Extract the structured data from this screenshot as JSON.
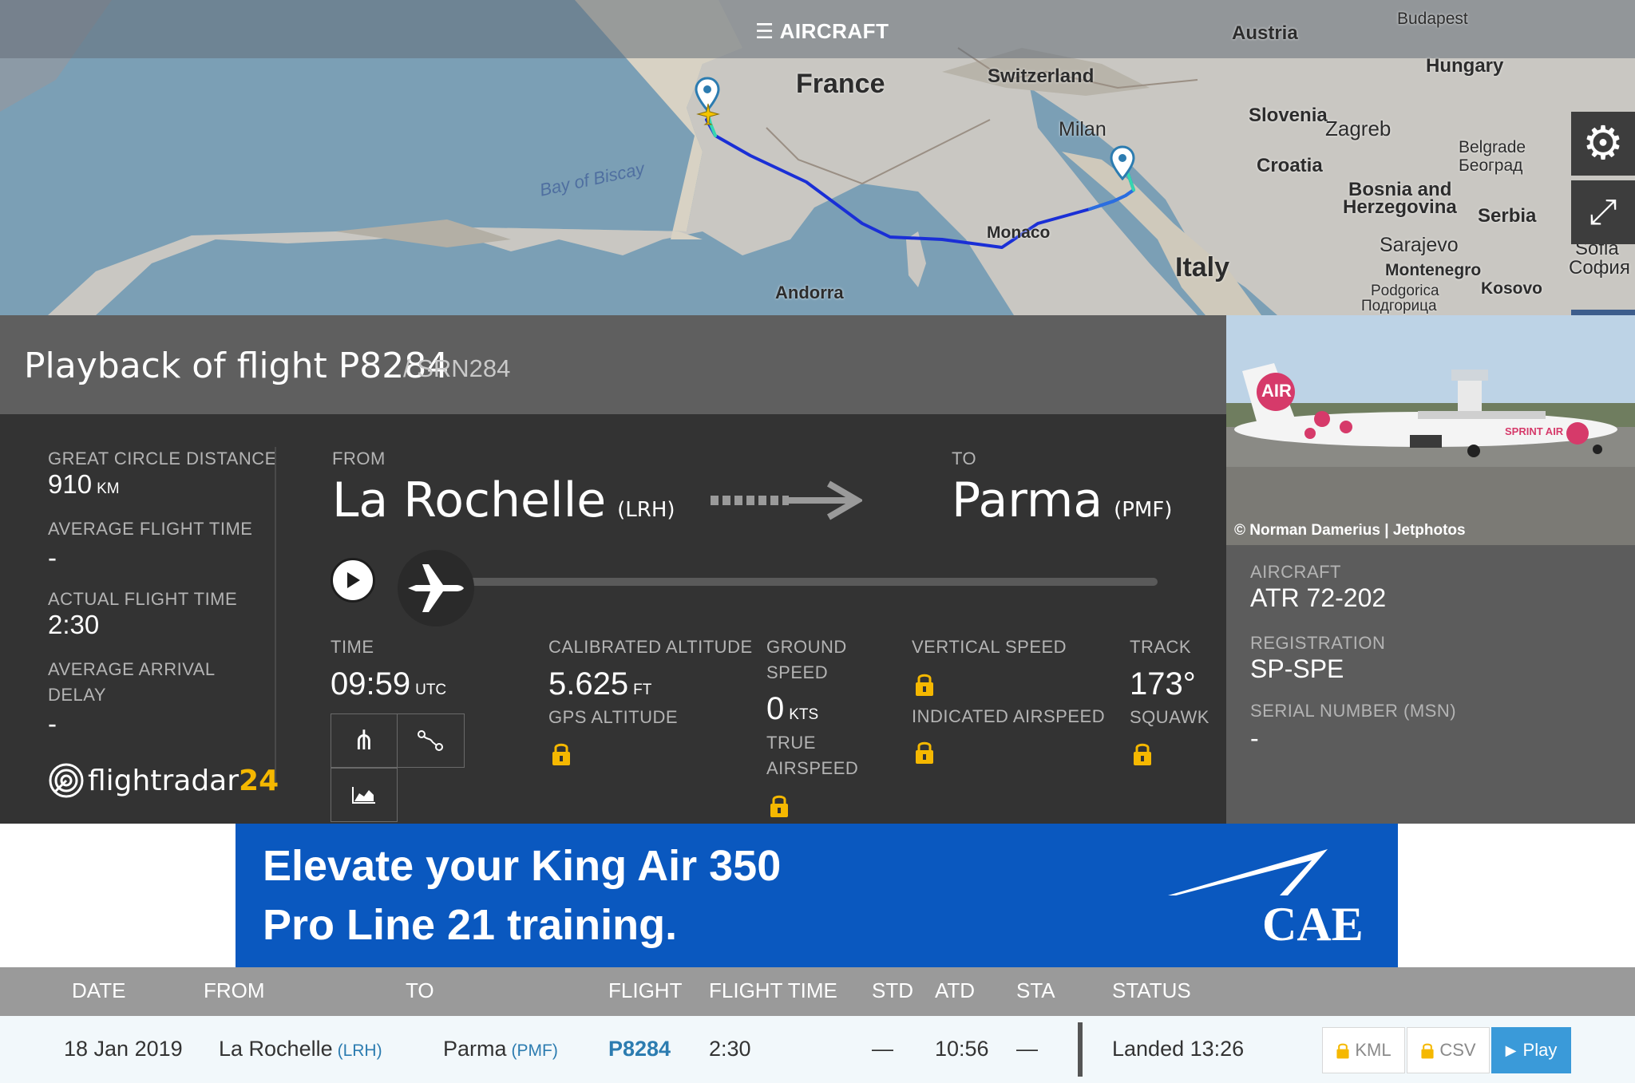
{
  "map": {
    "topbar_label": "AIRCRAFT",
    "labels": {
      "france": "France",
      "switzerland": "Switzerland",
      "austria": "Austria",
      "budapest": "Budapest",
      "hungary": "Hungary",
      "slovenia": "Slovenia",
      "zagreb": "Zagreb",
      "milan": "Milan",
      "croatia": "Croatia",
      "belgrade": "Belgrade",
      "belgrade_cyr": "Београд",
      "bosnia": "Bosnia and",
      "herzegovina": "Herzegovina",
      "serbia": "Serbia",
      "sarajevo": "Sarajevo",
      "montenegro": "Montenegro",
      "podgorica": "Podgorica",
      "podgorica_cyr": "Подгорица",
      "kosovo": "Kosovo",
      "sofia": "Sofia",
      "sofia_cyr": "София",
      "monaco": "Monaco",
      "italy": "Italy",
      "andorra": "Andorra",
      "bay_of_biscay": "Bay of Biscay"
    },
    "track_colors": [
      "#1a2fd6",
      "#2a6ee0",
      "#36d6b0",
      "#a4e05a"
    ]
  },
  "playback": {
    "title": "Playback of flight P8284",
    "callsign": "/ SRN284"
  },
  "stats": {
    "gcd_label": "GREAT CIRCLE DISTANCE",
    "gcd_value": "910",
    "gcd_unit": "KM",
    "aft_label": "AVERAGE FLIGHT TIME",
    "aft_value": "-",
    "actual_label": "ACTUAL FLIGHT TIME",
    "actual_value": "2:30",
    "delay_label_1": "AVERAGE ARRIVAL",
    "delay_label_2": "DELAY",
    "delay_value": "-"
  },
  "route": {
    "from_label": "FROM",
    "from_city": "La Rochelle",
    "from_code": "(LRH)",
    "to_label": "TO",
    "to_city": "Parma",
    "to_code": "(PMF)"
  },
  "playback_progress": 0.0,
  "telemetry": {
    "time_label": "TIME",
    "time_value": "09:59",
    "time_unit": "UTC",
    "cal_alt_label": "CALIBRATED ALTITUDE",
    "cal_alt_value": "5.625",
    "cal_alt_unit": "FT",
    "gps_alt_label": "GPS ALTITUDE",
    "ground_speed_label_1": "GROUND",
    "ground_speed_label_2": "SPEED",
    "ground_speed_value": "0",
    "ground_speed_unit": "KTS",
    "tas_label_1": "TRUE",
    "tas_label_2": "AIRSPEED",
    "vs_label": "VERTICAL SPEED",
    "ias_label": "INDICATED AIRSPEED",
    "track_label": "TRACK",
    "track_value": "173°",
    "squawk_label": "SQUAWK"
  },
  "brand": {
    "name": "flightradar",
    "suffix": "24"
  },
  "aircraft": {
    "photo_credit": "© Norman Damerius | Jetphotos",
    "type_label": "AIRCRAFT",
    "type_value": "ATR 72-202",
    "reg_label": "REGISTRATION",
    "reg_value": "SP-SPE",
    "msn_label": "SERIAL NUMBER (MSN)",
    "msn_value": "-",
    "livery_text_1": "AIR",
    "livery_text_2": "SPRINT AIR"
  },
  "ad": {
    "line1": "Elevate your King Air 350",
    "line2": "Pro Line 21 training.",
    "brand": "CAE"
  },
  "table": {
    "headers": [
      "DATE",
      "FROM",
      "TO",
      "FLIGHT",
      "FLIGHT TIME",
      "STD",
      "ATD",
      "STA",
      "STATUS"
    ],
    "row": {
      "date": "18 Jan 2019",
      "from": "La Rochelle",
      "from_code": "(LRH)",
      "to": "Parma",
      "to_code": "(PMF)",
      "flight": "P8284",
      "flight_time": "2:30",
      "std": "—",
      "atd": "10:56",
      "sta": "—",
      "status": "Landed 13:26",
      "kml": "KML",
      "csv": "CSV",
      "play": "Play"
    }
  },
  "colors": {
    "accent_yellow": "#f5b800",
    "link_blue": "#2c7cb0",
    "play_blue": "#3a9ad9",
    "ad_blue": "#0a58bf"
  }
}
